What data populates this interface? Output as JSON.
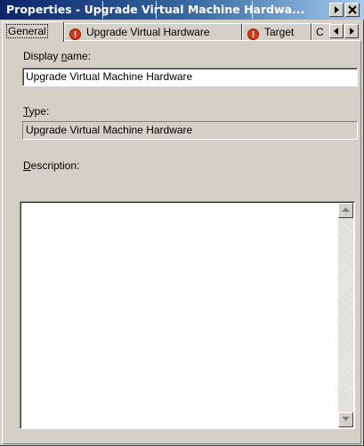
{
  "window": {
    "title": "Properties - Upgrade Virtual Machine Hardwa...",
    "buttons": {
      "menu_icon": "triangle-right-icon",
      "close_icon": "close-icon"
    }
  },
  "tabs": [
    {
      "label": "General",
      "active": true,
      "warning": false
    },
    {
      "label": "Upgrade Virtual Hardware",
      "active": false,
      "warning": true
    },
    {
      "label": "Target",
      "active": false,
      "warning": true
    },
    {
      "label": "C",
      "active": false,
      "warning": false
    }
  ],
  "tab_scroll": {
    "left_icon": "arrow-left-icon",
    "right_icon": "arrow-right-icon"
  },
  "form": {
    "display_name_label_pre": "Display ",
    "display_name_label_key": "n",
    "display_name_label_post": "ame:",
    "display_name_value": "Upgrade Virtual Machine Hardware",
    "type_label_key": "T",
    "type_label_post": "ype:",
    "type_value": "Upgrade Virtual Machine Hardware",
    "description_label_key": "D",
    "description_label_post": "escription:",
    "description_value": ""
  },
  "colors": {
    "titlebar_start": "#0a246a",
    "titlebar_end": "#a6caf0",
    "face": "#d4d0c8",
    "warning": "#d43a1a"
  }
}
